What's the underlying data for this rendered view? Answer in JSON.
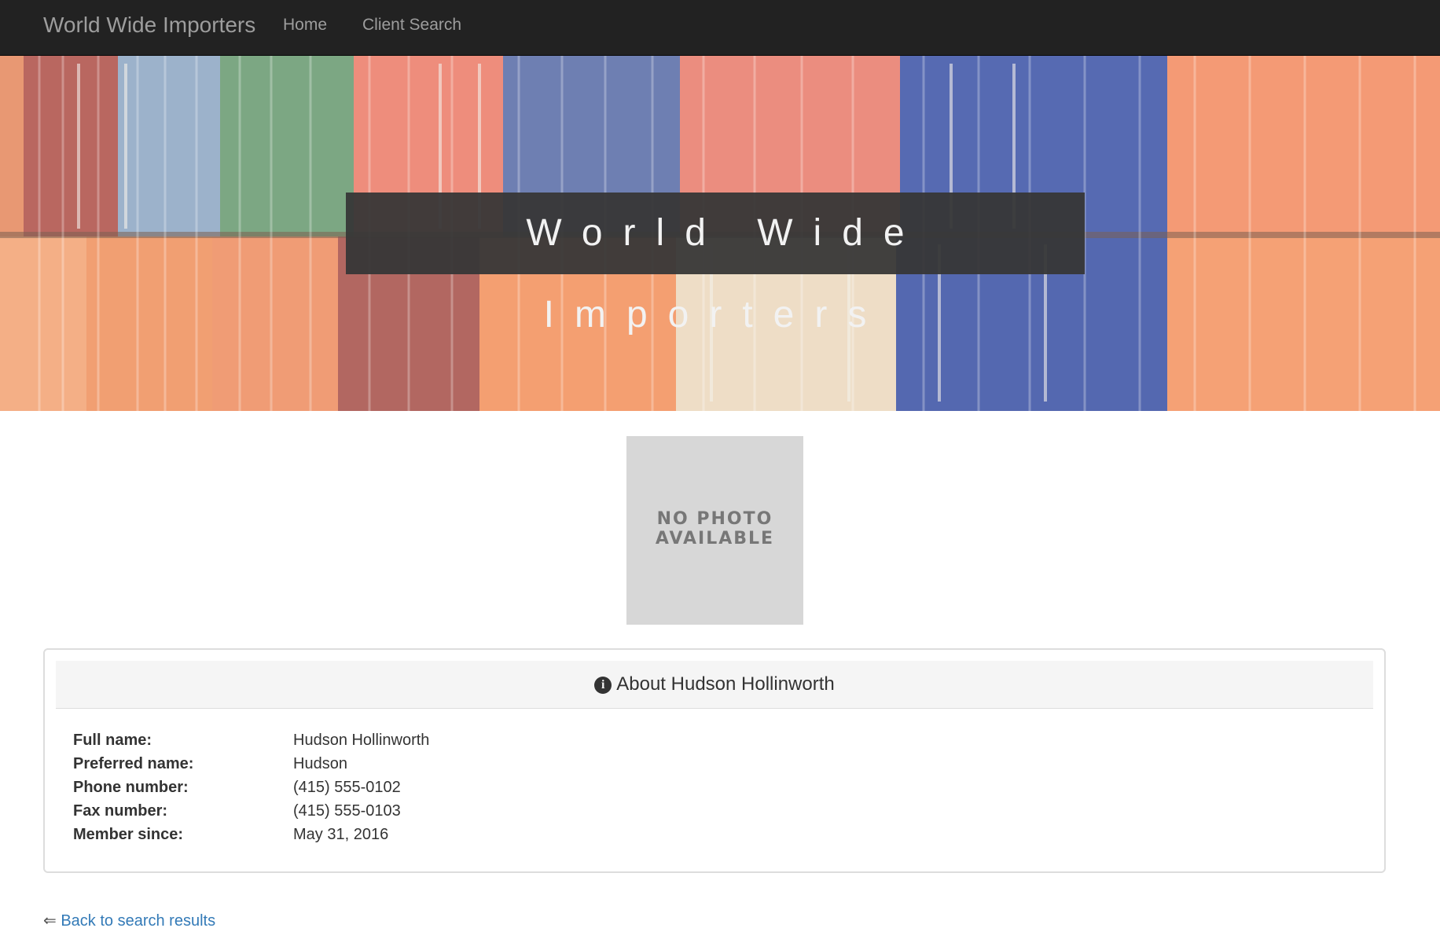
{
  "navbar": {
    "brand": "World Wide Importers",
    "links": [
      {
        "label": "Home"
      },
      {
        "label": "Client Search"
      }
    ]
  },
  "hero": {
    "title": "World Wide Importers"
  },
  "photo": {
    "line1": "NO PHOTO",
    "line2": "AVAILABLE"
  },
  "panel": {
    "icon": "info-circle-icon",
    "title": "About Hudson Hollinworth",
    "rows": [
      {
        "label": "Full name:",
        "value": "Hudson Hollinworth"
      },
      {
        "label": "Preferred name:",
        "value": "Hudson"
      },
      {
        "label": "Phone number:",
        "value": "(415) 555-0102"
      },
      {
        "label": "Fax number:",
        "value": "(415) 555-0103"
      },
      {
        "label": "Member since:",
        "value": "May 31, 2016"
      }
    ]
  },
  "back_link": {
    "arrow": "⇐",
    "label": "Back to search results"
  },
  "colors": {
    "navbar_bg": "#222222",
    "navbar_text": "#9d9d9d",
    "link": "#337ab7",
    "panel_heading_bg": "#f5f5f5"
  }
}
